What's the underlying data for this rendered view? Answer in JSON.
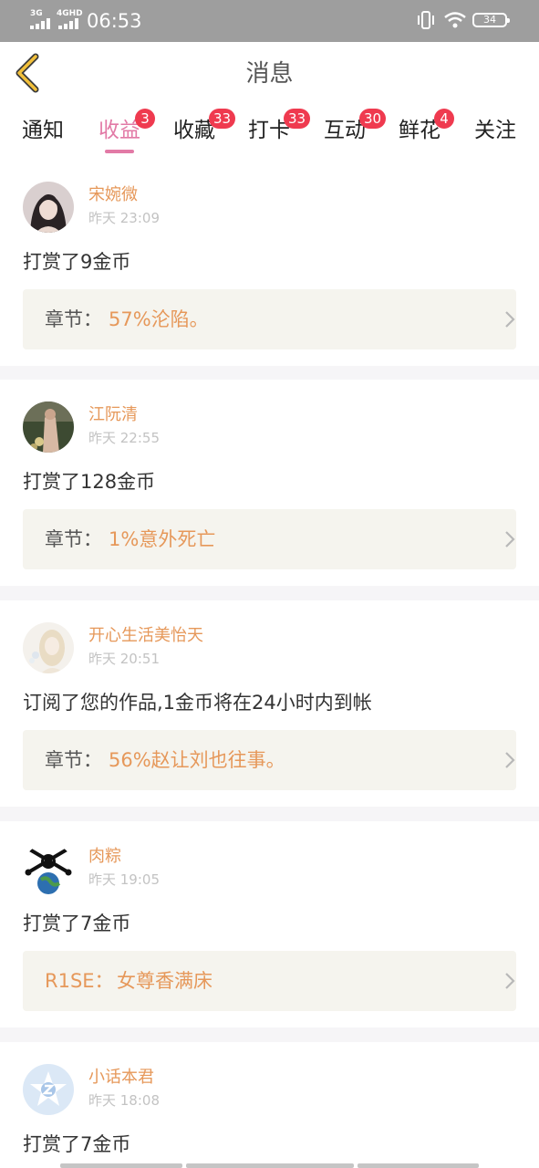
{
  "status": {
    "net1": "3G",
    "net2": "4GHD",
    "time": "06:53",
    "battery": "34"
  },
  "header": {
    "title": "消息",
    "back_icon": "chevron-left-icon"
  },
  "tabs": [
    {
      "label": "通知",
      "badge": ""
    },
    {
      "label": "收益",
      "badge": "3"
    },
    {
      "label": "收藏",
      "badge": "33"
    },
    {
      "label": "打卡",
      "badge": "33"
    },
    {
      "label": "互动",
      "badge": "30"
    },
    {
      "label": "鲜花",
      "badge": "4"
    },
    {
      "label": "关注",
      "badge": ""
    }
  ],
  "active_tab": "收益",
  "messages": [
    {
      "name": "宋婉微",
      "time": "昨天 23:09",
      "text": "打赏了9金币",
      "chapter_label": "章节：",
      "chapter_title": "57%沦陷。"
    },
    {
      "name": "江阮清",
      "time": "昨天 22:55",
      "text": "打赏了128金币",
      "chapter_label": "章节：",
      "chapter_title": "1%意外死亡"
    },
    {
      "name": "开心生活美怡天",
      "time": "昨天 20:51",
      "text": "订阅了您的作品,1金币将在24小时内到帐",
      "chapter_label": "章节：",
      "chapter_title": "56%赵让刘也往事。"
    },
    {
      "name": "肉粽",
      "time": "昨天 19:05",
      "text": "打赏了7金币",
      "chapter_label": "R1SE：",
      "chapter_title": "女尊香满床"
    },
    {
      "name": "小话本君",
      "time": "昨天 18:08",
      "text": "打赏了7金币",
      "chapter_label": "",
      "chapter_title": ""
    }
  ],
  "colors": {
    "accent_pink": "#e27aa6",
    "name_orange": "#e6985a",
    "badge_red": "#ef3a4f",
    "chapter_bg": "#f5f4ee"
  }
}
